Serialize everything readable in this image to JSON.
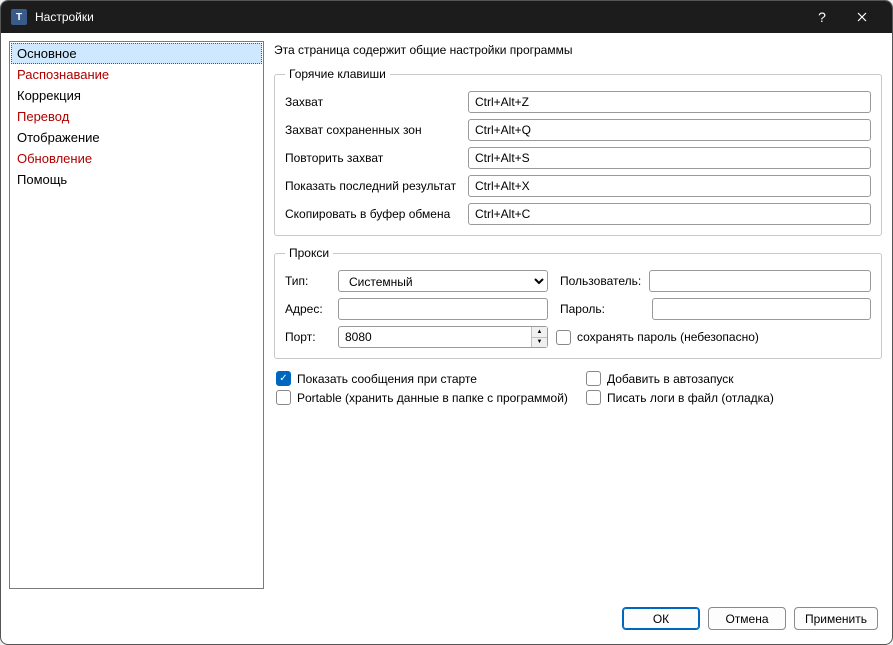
{
  "window": {
    "title": "Настройки"
  },
  "sidebar": {
    "items": [
      {
        "label": "Основное",
        "warn": false,
        "selected": true
      },
      {
        "label": "Распознавание",
        "warn": true,
        "selected": false
      },
      {
        "label": "Коррекция",
        "warn": false,
        "selected": false
      },
      {
        "label": "Перевод",
        "warn": true,
        "selected": false
      },
      {
        "label": "Отображение",
        "warn": false,
        "selected": false
      },
      {
        "label": "Обновление",
        "warn": true,
        "selected": false
      },
      {
        "label": "Помощь",
        "warn": false,
        "selected": false
      }
    ]
  },
  "page": {
    "description": "Эта страница содержит общие настройки программы"
  },
  "hotkeys": {
    "legend": "Горячие клавиши",
    "rows": [
      {
        "label": "Захват",
        "value": "Ctrl+Alt+Z"
      },
      {
        "label": "Захват сохраненных зон",
        "value": "Ctrl+Alt+Q"
      },
      {
        "label": "Повторить захват",
        "value": "Ctrl+Alt+S"
      },
      {
        "label": "Показать последний результат",
        "value": "Ctrl+Alt+X"
      },
      {
        "label": "Скопировать в буфер обмена",
        "value": "Ctrl+Alt+C"
      }
    ]
  },
  "proxy": {
    "legend": "Прокси",
    "type_label": "Тип:",
    "type_value": "Системный",
    "user_label": "Пользователь:",
    "user_value": "",
    "addr_label": "Адрес:",
    "addr_value": "",
    "pass_label": "Пароль:",
    "pass_value": "",
    "port_label": "Порт:",
    "port_value": "8080",
    "save_pass_label": "сохранять пароль (небезопасно)",
    "save_pass_checked": false
  },
  "options": {
    "show_startup": {
      "label": "Показать сообщения при старте",
      "checked": true
    },
    "autostart": {
      "label": "Добавить в автозапуск",
      "checked": false
    },
    "portable": {
      "label": "Portable (хранить данные в папке с программой)",
      "checked": false
    },
    "debuglog": {
      "label": "Писать логи в файл (отладка)",
      "checked": false
    }
  },
  "buttons": {
    "ok": "ОК",
    "cancel": "Отмена",
    "apply": "Применить"
  }
}
